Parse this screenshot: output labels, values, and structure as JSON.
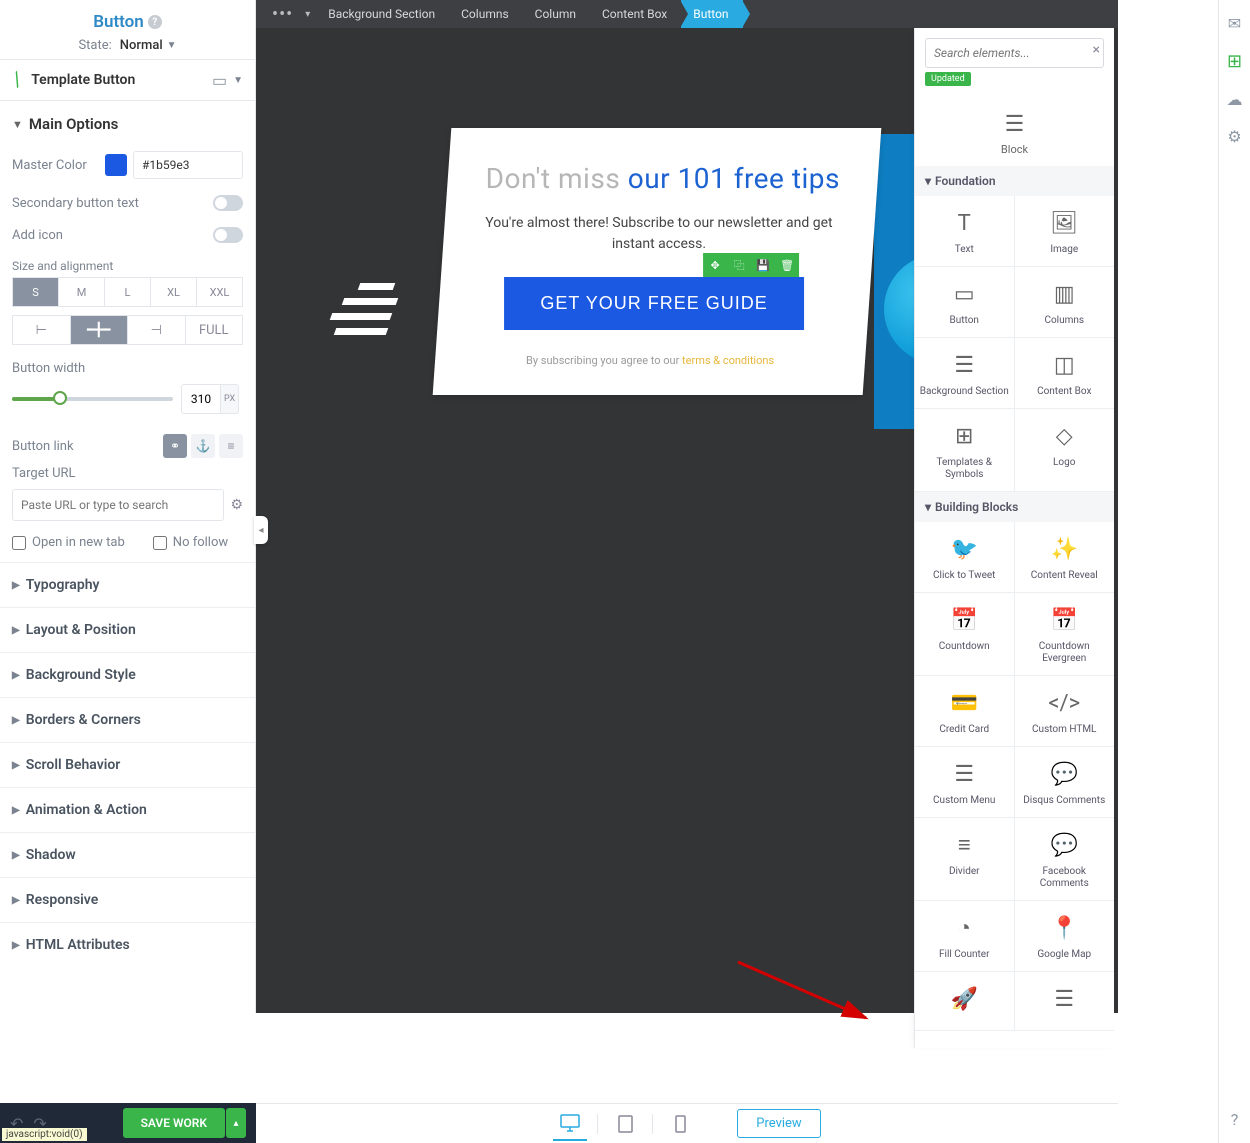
{
  "leftPanel": {
    "title": "Button",
    "stateLabel": "State:",
    "stateValue": "Normal",
    "templateButton": "Template Button",
    "mainOptions": "Main Options",
    "masterColorLabel": "Master Color",
    "masterColorValue": "#1b59e3",
    "secondaryBtnText": "Secondary button text",
    "addIcon": "Add icon",
    "sizeAlignLabel": "Size and alignment",
    "sizes": [
      "S",
      "M",
      "L",
      "XL",
      "XXL"
    ],
    "fullLabel": "FULL",
    "buttonWidthLabel": "Button width",
    "buttonWidthValue": "310",
    "buttonWidthUnit": "PX",
    "buttonLinkLabel": "Button link",
    "targetUrlLabel": "Target URL",
    "urlPlaceholder": "Paste URL or type to search",
    "openNewTab": "Open in new tab",
    "noFollow": "No follow",
    "sections": [
      "Typography",
      "Layout & Position",
      "Background Style",
      "Borders & Corners",
      "Scroll Behavior",
      "Animation & Action",
      "Shadow",
      "Responsive",
      "HTML Attributes"
    ]
  },
  "bottomBar": {
    "save": "SAVE WORK",
    "preview": "Preview",
    "jsBadge": "javascript:void(0)"
  },
  "breadcrumbs": [
    "Background Section",
    "Columns",
    "Column",
    "Content Box",
    "Button"
  ],
  "canvas": {
    "titlePart1": "Don't miss ",
    "titlePart2": "our 101 free tips",
    "subtitle": "You're almost there! Subscribe to our newsletter and get instant access.",
    "cta": "GET YOUR FREE GUIDE",
    "termsPrefix": "By subscribing you agree to our ",
    "termsLink": "terms & conditions"
  },
  "rightPanel": {
    "searchPlaceholder": "Search elements...",
    "updatedBadge": "Updated",
    "blockLabel": "Block",
    "groups": {
      "foundation": "Foundation",
      "buildingBlocks": "Building Blocks"
    },
    "foundationItems": [
      "Text",
      "Image",
      "Button",
      "Columns",
      "Background Section",
      "Content Box",
      "Templates & Symbols",
      "Logo"
    ],
    "buildingItems": [
      "Click to Tweet",
      "Content Reveal",
      "Countdown",
      "Countdown Evergreen",
      "Credit Card",
      "Custom HTML",
      "Custom Menu",
      "Disqus Comments",
      "Divider",
      "Facebook Comments",
      "Fill Counter",
      "Google Map"
    ]
  }
}
